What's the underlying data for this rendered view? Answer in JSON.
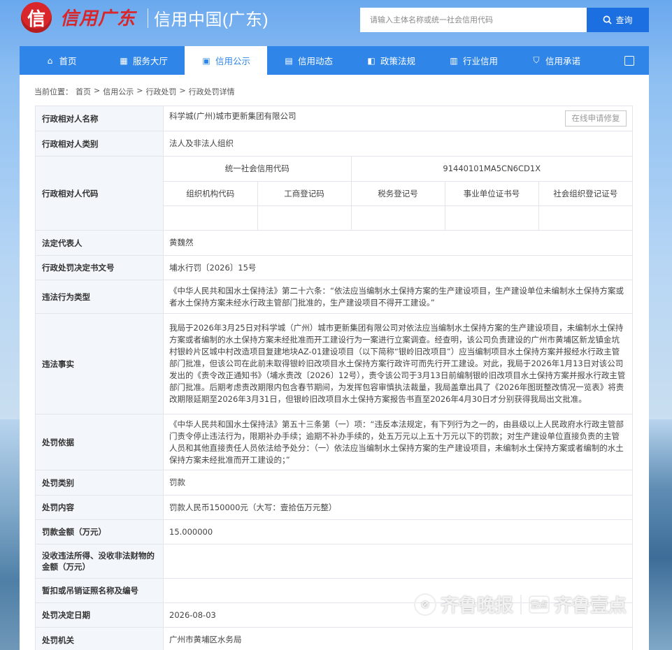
{
  "header": {
    "logo_char": "信",
    "calligraphy": "信用广东",
    "site_name": "信用中国(广东)",
    "search_placeholder": "请输入主体名称或统一社会信用代码",
    "search_button": "查询"
  },
  "nav": {
    "items": [
      {
        "label": "首页",
        "icon": "home-icon"
      },
      {
        "label": "服务大厅",
        "icon": "grid-icon"
      },
      {
        "label": "信用公示",
        "icon": "announce-icon",
        "active": true
      },
      {
        "label": "信用动态",
        "icon": "doc-icon"
      },
      {
        "label": "政策法规",
        "icon": "book-icon"
      },
      {
        "label": "行业信用",
        "icon": "building-icon"
      },
      {
        "label": "信用承诺",
        "icon": "shield-icon"
      }
    ],
    "expand_icon": "expand-icon"
  },
  "breadcrumb": {
    "prefix": "当前位置：",
    "items": [
      "首页",
      "信用公示",
      "行政处罚",
      "行政处罚详情"
    ],
    "sep": ">"
  },
  "detail": {
    "name_label": "行政相对人名称",
    "name_value": "科学城(广州)城市更新集团有限公司",
    "repair_button": "在线申请修复",
    "type_label": "行政相对人类别",
    "type_value": "法人及非法人组织",
    "code_label": "行政相对人代码",
    "uscc_label": "统一社会信用代码",
    "uscc_value": "91440101MA5CN6CD1X",
    "code_headers": [
      "组织机构代码",
      "工商登记码",
      "税务登记号",
      "事业单位证书号",
      "社会组织登记证号"
    ],
    "code_values": [
      "",
      "",
      "",
      "",
      ""
    ],
    "legal_rep_label": "法定代表人",
    "legal_rep_value": "黄魏然",
    "doc_no_label": "行政处罚决定书文号",
    "doc_no_value": "埔水行罚〔2026〕15号",
    "violation_type_label": "违法行为类型",
    "violation_type_value": "《中华人民共和国水土保持法》第二十六条：“依法应当编制水土保持方案的生产建设项目，生产建设单位未编制水土保持方案或者水土保持方案未经水行政主管部门批准的，生产建设项目不得开工建设。”",
    "facts_label": "违法事实",
    "facts_value": "我局于2026年3月25日对科学城（广州）城市更新集团有限公司对依法应当编制水土保持方案的生产建设项目，未编制水土保持方案或者编制的水土保持方案未经批准而开工建设行为一案进行立案调查。经查明，该公司负责建设的广州市黄埔区新龙镇金坑村银岭片区城中村改造项目复建地块AZ-01建设项目（以下简称“银岭旧改项目”）应当编制项目水土保持方案并报经水行政主管部门批准，但该公司在此前未取得银岭旧改项目水土保持方案行政许可而先行开工建设。对此，我局于2026年1月13日对该公司发出的《责令改正通知书》（埔水责改〔2026〕12号），责令该公司于3月13日前编制银岭旧改项目水土保持方案并报水行政主管部门批准。后期考虑责改期限内包含春节期间，为发挥包容审慎执法裁量，我局盖章出具了《2026年图斑整改情况一览表》将责改期限延期至2026年3月31日，但银岭旧改项目水土保持方案报告书直至2026年4月30日才分别获得我局出文批准。",
    "basis_label": "处罚依据",
    "basis_value": "《中华人民共和国水土保持法》第五十三条第（一）项：“违反本法规定，有下列行为之一的，由县级以上人民政府水行政主管部门责令停止违法行为，限期补办手续；逾期不补办手续的，处五万元以上五十万元以下的罚款；对生产建设单位直接负责的主管人员和其他直接责任人员依法给予处分：（一）依法应当编制水土保持方案的生产建设项目，未编制水土保持方案或者编制的水土保持方案未经批准而开工建设的；”",
    "category_label": "处罚类别",
    "category_value": "罚款",
    "content_label": "处罚内容",
    "content_value": "罚款人民币150000元（大写：壹拾伍万元整）",
    "amount_label": "罚款金额（万元）",
    "amount_value": "15.000000",
    "confiscate_label": "没收违法所得、没收非法财物的金额（万元）",
    "confiscate_value": "",
    "license_label": "暂扣或吊销证照名称及编号",
    "license_value": "",
    "date_label": "处罚决定日期",
    "date_value": "2026-08-03",
    "authority_label": "处罚机关",
    "authority_value": "广州市黄埔区水务局"
  },
  "watermark": {
    "text1": "齐鲁晚报",
    "badge": "壹点",
    "text2": "齐鲁壹点"
  }
}
